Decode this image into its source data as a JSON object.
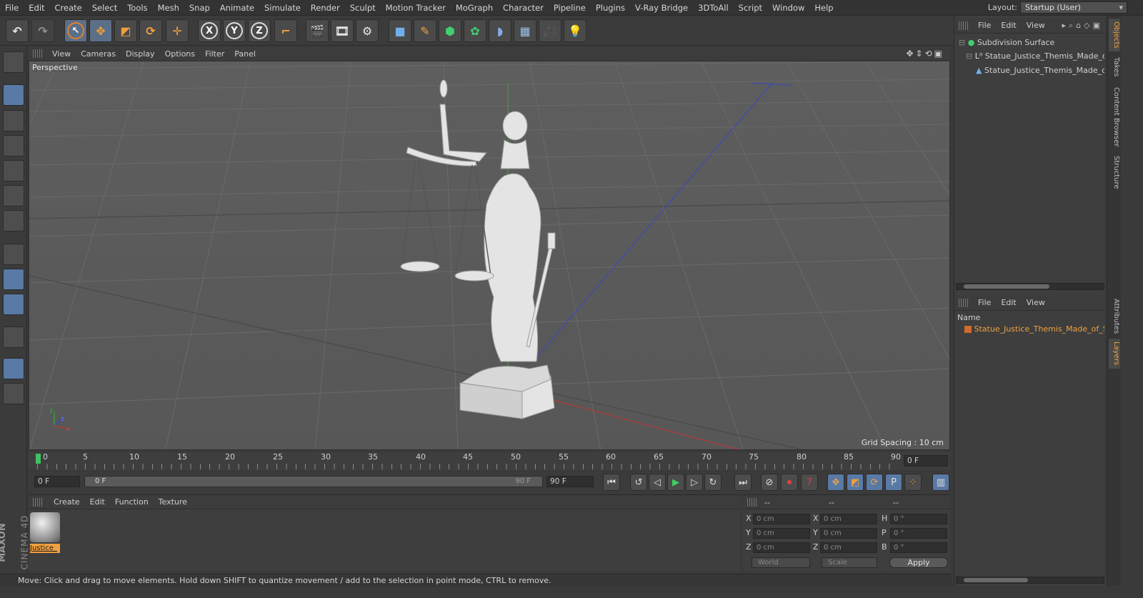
{
  "menubar": {
    "items": [
      "File",
      "Edit",
      "Create",
      "Select",
      "Tools",
      "Mesh",
      "Snap",
      "Animate",
      "Simulate",
      "Render",
      "Sculpt",
      "Motion Tracker",
      "MoGraph",
      "Character",
      "Pipeline",
      "Plugins",
      "V-Ray Bridge",
      "3DToAll",
      "Script",
      "Window",
      "Help"
    ],
    "layout_label": "Layout:",
    "layout_value": "Startup (User)"
  },
  "toolbar": {
    "axis_x": "X",
    "axis_y": "Y",
    "axis_z": "Z"
  },
  "viewport": {
    "menu": [
      "View",
      "Cameras",
      "Display",
      "Options",
      "Filter",
      "Panel"
    ],
    "camera_label": "Perspective",
    "grid_spacing": "Grid Spacing : 10 cm",
    "axis_y": "y",
    "axis_z": "z",
    "axis_x": "x"
  },
  "timeline": {
    "ticks": [
      "0",
      "5",
      "10",
      "15",
      "20",
      "25",
      "30",
      "35",
      "40",
      "45",
      "50",
      "55",
      "60",
      "65",
      "70",
      "75",
      "80",
      "85",
      "90"
    ],
    "current_frame": "0 F",
    "start_frame": "0 F",
    "range_start": "0 F",
    "range_end": "90 F",
    "end_frame": "90 F"
  },
  "material_panel": {
    "menu": [
      "Create",
      "Edit",
      "Function",
      "Texture"
    ],
    "material_name": "Justice_"
  },
  "coords": {
    "header": [
      "--",
      "--",
      "--"
    ],
    "rows": [
      {
        "a": "X",
        "av": "0 cm",
        "b": "X",
        "bv": "0 cm",
        "c": "H",
        "cv": "0 °"
      },
      {
        "a": "Y",
        "av": "0 cm",
        "b": "Y",
        "bv": "0 cm",
        "c": "P",
        "cv": "0 °"
      },
      {
        "a": "Z",
        "av": "0 cm",
        "b": "Z",
        "bv": "0 cm",
        "c": "B",
        "cv": "0 °"
      }
    ],
    "mode1": "World",
    "mode2": "Scale",
    "apply": "Apply"
  },
  "status": "Move: Click and drag to move elements. Hold down SHIFT to quantize movement / add to the selection in point mode, CTRL to remove.",
  "objects_panel": {
    "menu": [
      "File",
      "Edit",
      "View"
    ],
    "items": [
      "Subdivision Surface",
      "Statue_Justice_Themis_Made_of_",
      "Statue_Justice_Themis_Made_c"
    ]
  },
  "layers_panel": {
    "menu": [
      "File",
      "Edit",
      "View"
    ],
    "column": "Name",
    "item": "Statue_Justice_Themis_Made_of_S"
  },
  "side_tabs": [
    "Objects",
    "Takes",
    "Content Browser",
    "Structure",
    "Attributes",
    "Layers"
  ],
  "logo": {
    "brand": "MAXON",
    "product": "CINEMA 4D"
  },
  "colors": {
    "accent": "#f0a040",
    "active_blue": "#5a7aa6",
    "grid_bg": "#5c5c5c"
  }
}
